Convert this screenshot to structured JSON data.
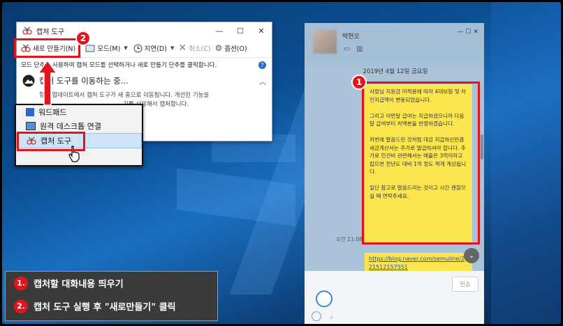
{
  "snipping_tool": {
    "title": "캡처 도구",
    "controls": [
      "—",
      "☐",
      "✕"
    ],
    "toolbar": {
      "new": "새로 만들기(N)",
      "mode": "모드(M)",
      "delay": "지연(D)",
      "cancel": "취소(C)",
      "options": "옵션(O)"
    },
    "hint": "모드 단추를 사용하여 캡처 모드를 선택하거나 새로 만들기 단추를 클릭합니다.",
    "notice_title": "캡처 도구를 이동하는 중...",
    "notice_body_1": "향후 업데이트에서 캡처 도구가 새 홈으로 이동됩니다. 개선된 기능을",
    "notice_body_2": "기를 사용해서 캡처합니다."
  },
  "start_menu": {
    "items": [
      "워드패드",
      "원격 데스크톱 연결",
      "캡처 도구"
    ]
  },
  "chat": {
    "contact_name": "박현오",
    "date": "2019년 4월 12일 금요일",
    "message": "사장님 지원금 미적용에 따라 4대보험 및 차인지급액이 변동되었습니다.\n\n그리고 이번달 급여는 지급하셨으니까 다음달 급여부터 차액분을 반영하겠습니다.\n\n저번에 말씀드린 것처럼 대금 지급하신만큼 세금계산서는 추가로 발급하셔야 합니다. 추가로 인건비 관련해서는 매출은 3억이라고 잡으면 전년도 대비 1억 정도 적게 계상됩니다.\n\n일단 참고로 말씀드리는 것이고 시간 괜찮으실 때 연락주세요.",
    "time": "오전 11:08",
    "link": "https://blog.naver.com/semuline/221512157551",
    "send_label": "전송"
  },
  "badges": [
    "1",
    "2"
  ],
  "captions": [
    {
      "num": "1.",
      "text": "캡처할 대화내용 띄우기"
    },
    {
      "num": "2.",
      "text": "캡처 도구 실행 후 \"새로만들기\" 클릭"
    }
  ],
  "colors": {
    "highlight": "#e0161c",
    "chat_bubble": "#fbe64f",
    "desktop": "#0b4f93"
  }
}
